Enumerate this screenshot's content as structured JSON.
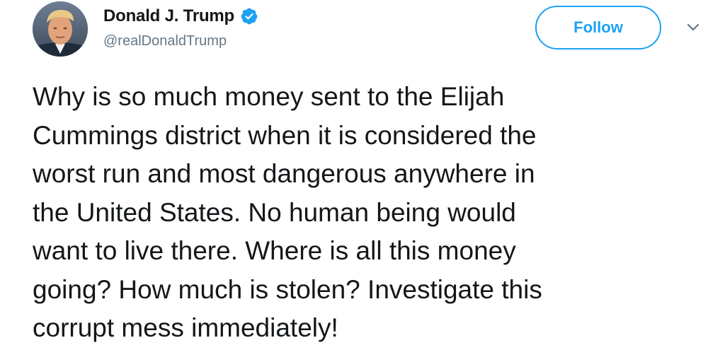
{
  "author": {
    "display_name": "Donald J. Trump",
    "handle": "@realDonaldTrump",
    "verified": true,
    "avatar_icon": "profile-photo"
  },
  "actions": {
    "follow_label": "Follow",
    "menu_icon": "chevron-down-icon"
  },
  "tweet": {
    "text": "Why is so much money sent to the Elijah\nCummings district when it is considered the\nworst run and most dangerous anywhere in\nthe United States. No human being would\nwant to live there. Where is all this money\ngoing? How much is stolen? Investigate this\ncorrupt mess immediately!"
  },
  "colors": {
    "accent": "#1da1f2",
    "text": "#14171a",
    "secondary_text": "#657786",
    "background": "#ffffff"
  }
}
